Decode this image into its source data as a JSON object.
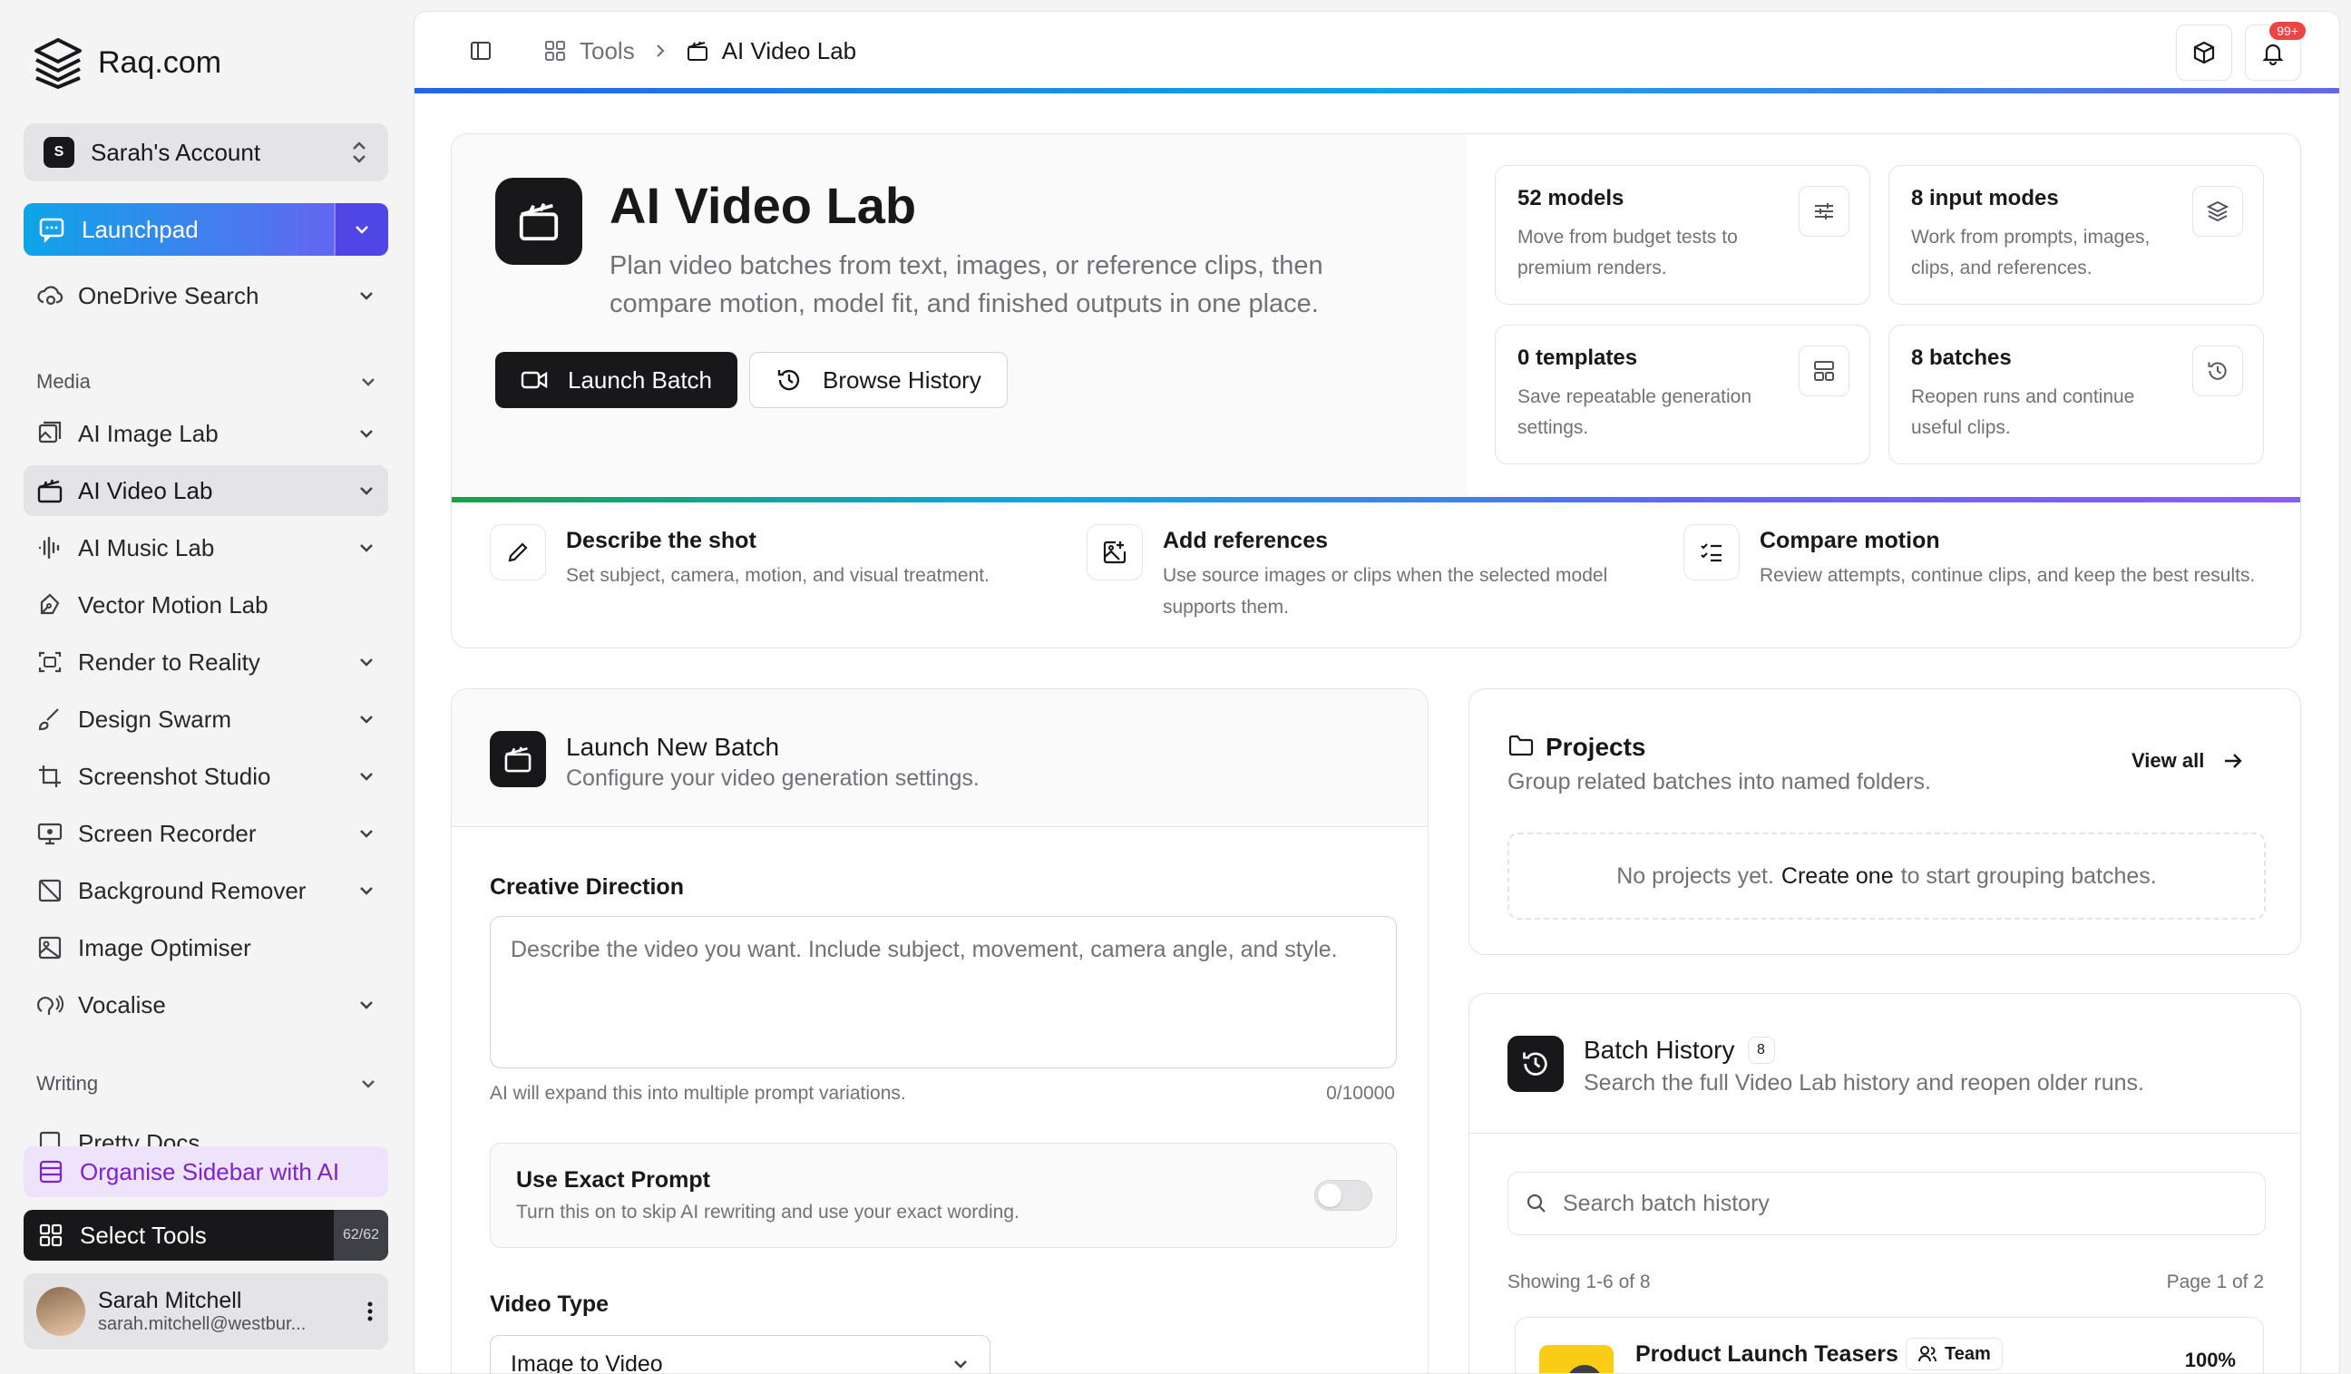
{
  "brand": {
    "name": "Raq.com"
  },
  "account": {
    "initial": "S",
    "name": "Sarah's Account"
  },
  "sidebar": {
    "launchpad_label": "Launchpad",
    "onedrive_label": "OneDrive Search",
    "media_heading": "Media",
    "media_items": [
      {
        "label": "AI Image Lab",
        "icon": "image-lab-icon",
        "has_chevron": true
      },
      {
        "label": "AI Video Lab",
        "icon": "clapperboard-icon",
        "has_chevron": true,
        "active": true
      },
      {
        "label": "AI Music Lab",
        "icon": "audio-wave-icon",
        "has_chevron": true
      },
      {
        "label": "Vector Motion Lab",
        "icon": "pen-tool-icon",
        "has_chevron": false
      },
      {
        "label": "Render to Reality",
        "icon": "scan-image-icon",
        "has_chevron": true
      },
      {
        "label": "Design Swarm",
        "icon": "brush-icon",
        "has_chevron": true
      },
      {
        "label": "Screenshot Studio",
        "icon": "crop-icon",
        "has_chevron": true
      },
      {
        "label": "Screen Recorder",
        "icon": "monitor-record-icon",
        "has_chevron": true
      },
      {
        "label": "Background Remover",
        "icon": "image-off-icon",
        "has_chevron": true
      },
      {
        "label": "Image Optimiser",
        "icon": "image-icon",
        "has_chevron": false
      },
      {
        "label": "Vocalise",
        "icon": "speech-icon",
        "has_chevron": true
      }
    ],
    "writing_heading": "Writing",
    "writing_partial_item": "Pretty Docs",
    "organise_label": "Organise Sidebar with AI",
    "select_tools_label": "Select Tools",
    "select_tools_count": "62/62"
  },
  "user": {
    "name": "Sarah Mitchell",
    "email": "sarah.mitchell@westbur..."
  },
  "breadcrumb": {
    "root": "Tools",
    "current": "AI Video Lab"
  },
  "notifications": {
    "count": "99+"
  },
  "hero": {
    "title": "AI Video Lab",
    "subtitle": "Plan video batches from text, images, or reference clips, then compare motion, model fit, and finished outputs in one place.",
    "primary_button": "Launch Batch",
    "secondary_button": "Browse History",
    "stats": [
      {
        "title": "52 models",
        "desc": "Move from budget tests to premium renders.",
        "icon": "sliders-icon"
      },
      {
        "title": "8 input modes",
        "desc": "Work from prompts, images, clips, and references.",
        "icon": "layers-icon"
      },
      {
        "title": "0 templates",
        "desc": "Save repeatable generation settings.",
        "icon": "layout-template-icon"
      },
      {
        "title": "8 batches",
        "desc": "Reopen runs and continue useful clips.",
        "icon": "history-icon"
      }
    ],
    "steps": [
      {
        "title": "Describe the shot",
        "desc": "Set subject, camera, motion, and visual treatment.",
        "icon": "pencil-icon"
      },
      {
        "title": "Add references",
        "desc": "Use source images or clips when the selected model supports them.",
        "icon": "image-plus-icon"
      },
      {
        "title": "Compare motion",
        "desc": "Review attempts, continue clips, and keep the best results.",
        "icon": "list-checks-icon"
      }
    ]
  },
  "launch_card": {
    "title": "Launch New Batch",
    "subtitle": "Configure your video generation settings.",
    "creative_label": "Creative Direction",
    "creative_placeholder": "Describe the video you want. Include subject, movement, camera angle, and style.",
    "creative_hint": "AI will expand this into multiple prompt variations.",
    "char_count": "0/10000",
    "exact_title": "Use Exact Prompt",
    "exact_desc": "Turn this on to skip AI rewriting and use your exact wording.",
    "video_type_label": "Video Type",
    "video_type_value": "Image to Video"
  },
  "projects": {
    "title": "Projects",
    "subtitle": "Group related batches into named folders.",
    "view_all": "View all",
    "empty_prefix": "No projects yet.",
    "empty_link": "Create one",
    "empty_suffix": "to start grouping batches."
  },
  "history": {
    "title": "Batch History",
    "count": "8",
    "subtitle": "Search the full Video Lab history and reopen older runs.",
    "search_placeholder": "Search batch history",
    "showing": "Showing 1-6 of 8",
    "page": "Page 1 of 2",
    "first_row": {
      "title": "Product Launch Teasers",
      "tag": "Team",
      "progress": "100%"
    }
  }
}
